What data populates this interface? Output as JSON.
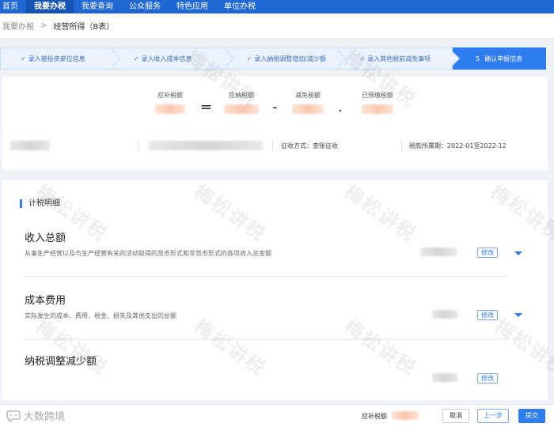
{
  "nav": {
    "items": [
      {
        "label": "首页"
      },
      {
        "label": "我要办税"
      },
      {
        "label": "我要查询"
      },
      {
        "label": "公众服务"
      },
      {
        "label": "特色应用"
      },
      {
        "label": "单位办税"
      }
    ],
    "active_index": 1
  },
  "breadcrumb": {
    "parent": "我要办税",
    "separator": ">",
    "current": "经营所得（B表）"
  },
  "steps": [
    {
      "label": "录入被投资单位信息",
      "done": true
    },
    {
      "label": "录入收入成本信息",
      "done": true
    },
    {
      "label": "录入纳税调整增加/减少额",
      "done": true
    },
    {
      "label": "录入其他税前减免事项",
      "done": true
    },
    {
      "number": "5",
      "label": "确认申报信息",
      "done": false
    }
  ],
  "formula": {
    "due_label": "应补税额",
    "equals": "=",
    "payable_label": "应纳税额",
    "minus": "-",
    "reduction_label": "减免税额",
    "dot": ".",
    "prepaid_label": "已预缴税额"
  },
  "info": {
    "collection_label": "征收方式：",
    "collection_value": "查账征收",
    "period_label": "税款所属期：",
    "period_value": "2022-01至2022-12"
  },
  "detail": {
    "title": "计税明细",
    "rows": [
      {
        "title": "收入总额",
        "desc": "从事生产经营以及与生产经营有关的活动取得的货币形式和非货币形式的各项收入总金额",
        "edit": "修改"
      },
      {
        "title": "成本费用",
        "desc": "实际发生的成本、费用、税金、损失及其他支出的总额",
        "edit": "修改"
      },
      {
        "title": "纳税调整减少额",
        "desc": "",
        "edit": "修改"
      }
    ]
  },
  "footer": {
    "logo_text": "大数跨境",
    "due_label": "应补税额",
    "cancel": "取消",
    "prev": "上一步",
    "submit": "提交"
  },
  "watermark": "梅松讲税",
  "colors": {
    "nav": "#1f67d2",
    "accent": "#2f7cf0",
    "step_bg": "#eaf2fd"
  }
}
